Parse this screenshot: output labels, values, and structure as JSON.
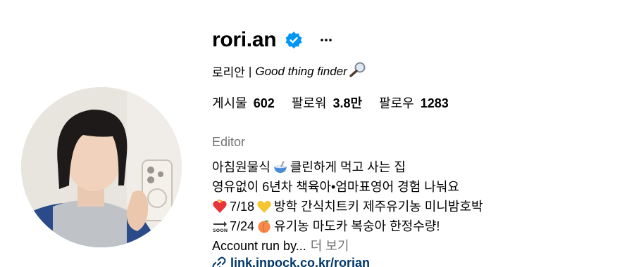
{
  "profile": {
    "username": "rori.an",
    "name": "로리안",
    "separator": "|",
    "tagline": "Good thing finder",
    "stats": {
      "posts_label": "게시물",
      "posts_value": "602",
      "followers_label": "팔로워",
      "followers_value": "3.8만",
      "following_label": "팔로우",
      "following_value": "1283"
    },
    "category": "Editor",
    "bio": {
      "line1_a": "아침원물식",
      "line1_b": "클린하게 먹고 사는 집",
      "line2": "영유없이 6년차 책육아•엄마표영어 경험 나눠요",
      "line3_a": "7/18",
      "line3_b": "방학 간식치트키 제주유기농 미니밤호박",
      "line4_a": "7/24",
      "line4_b": "유기농 마도카 복숭아 한정수량!",
      "line5": "Account run by...",
      "more_label": "더 보기"
    },
    "link": "link.inpock.co.kr/rorian"
  },
  "icons": {
    "verified": "verified-badge-icon",
    "more": "more-options-icon",
    "magnifier": "magnifying-glass-icon",
    "bowl": "bowl-icon",
    "heart": "burning-heart-icon",
    "yellow_heart": "yellow-heart-icon",
    "soon": "soon-arrow-icon",
    "peach": "peach-icon",
    "link": "link-icon"
  },
  "colors": {
    "verified_blue": "#0095f6",
    "secondary_text": "#737373",
    "link_text": "#00376b"
  }
}
